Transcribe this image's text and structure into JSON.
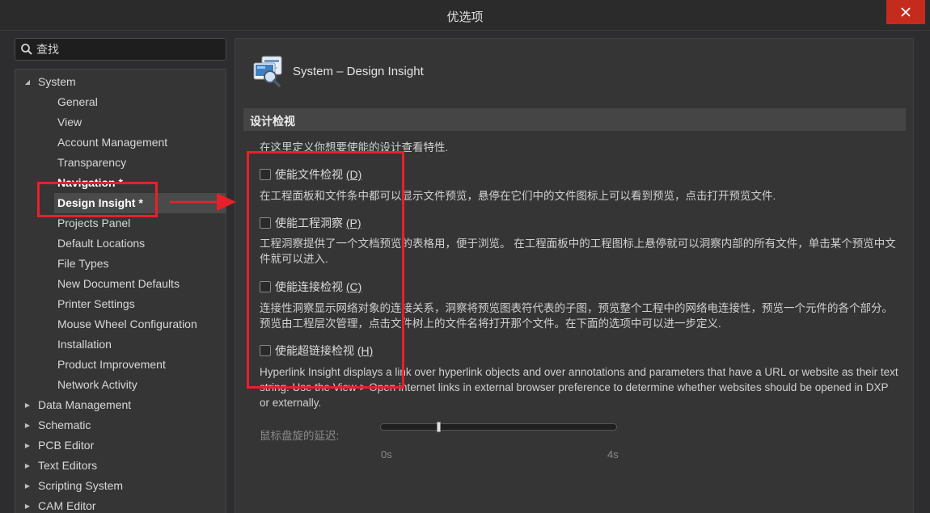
{
  "window": {
    "title": "优选项"
  },
  "search": {
    "value": "查找"
  },
  "tree": {
    "items": [
      {
        "label": "System",
        "level": 0,
        "expanded": true
      },
      {
        "label": "General",
        "level": 1
      },
      {
        "label": "View",
        "level": 1
      },
      {
        "label": "Account Management",
        "level": 1
      },
      {
        "label": "Transparency",
        "level": 1
      },
      {
        "label": "Navigation *",
        "level": 1,
        "bold": true
      },
      {
        "label": "Design Insight *",
        "level": 1,
        "bold": true,
        "selected": true
      },
      {
        "label": "Projects Panel",
        "level": 1
      },
      {
        "label": "Default Locations",
        "level": 1
      },
      {
        "label": "File Types",
        "level": 1
      },
      {
        "label": "New Document Defaults",
        "level": 1
      },
      {
        "label": "Printer Settings",
        "level": 1
      },
      {
        "label": "Mouse Wheel Configuration",
        "level": 1
      },
      {
        "label": "Installation",
        "level": 1
      },
      {
        "label": "Product Improvement",
        "level": 1
      },
      {
        "label": "Network Activity",
        "level": 1
      },
      {
        "label": "Data Management",
        "level": 0,
        "expanded": false
      },
      {
        "label": "Schematic",
        "level": 0,
        "expanded": false
      },
      {
        "label": "PCB Editor",
        "level": 0,
        "expanded": false
      },
      {
        "label": "Text Editors",
        "level": 0,
        "expanded": false
      },
      {
        "label": "Scripting System",
        "level": 0,
        "expanded": false
      },
      {
        "label": "CAM Editor",
        "level": 0,
        "expanded": false
      }
    ]
  },
  "page": {
    "title": "System – Design Insight",
    "section_title": "设计检视",
    "intro": "在这里定义你想要使能的设计查看特性.",
    "options": [
      {
        "label": "使能文件检视",
        "shortcut": "(D)",
        "checked": false,
        "description": "在工程面板和文件条中都可以显示文件预览，悬停在它们中的文件图标上可以看到预览，点击打开预览文件."
      },
      {
        "label": "使能工程洞察",
        "shortcut": "(P)",
        "checked": false,
        "description": "工程洞察提供了一个文档预览的表格用，便于浏览。 在工程面板中的工程图标上悬停就可以洞察内部的所有文件，单击某个预览中文件就可以进入."
      },
      {
        "label": "使能连接检视",
        "shortcut": "(C)",
        "checked": false,
        "description": "连接性洞察显示网络对象的连接关系，洞察将预览图表符代表的子图，预览整个工程中的网络电连接性，预览一个元件的各个部分。预览由工程层次管理，点击文件树上的文件名将打开那个文件。在下面的选项中可以进一步定义."
      },
      {
        "label": "使能超链接检视",
        "shortcut": "(H)",
        "checked": false,
        "description": "Hyperlink Insight displays a link over hyperlink objects and over annotations and parameters that have a URL or website as their text string. Use the View > Open internet links in external browser preference to determine whether websites should be opened in DXP or externally."
      }
    ],
    "hover_delay": {
      "label": "鼠标盘旋的延迟:",
      "min_label": "0s",
      "max_label": "4s",
      "value_fraction": 0.25
    }
  },
  "colors": {
    "annotation": "#e8202a",
    "close_button": "#c42b1c"
  }
}
